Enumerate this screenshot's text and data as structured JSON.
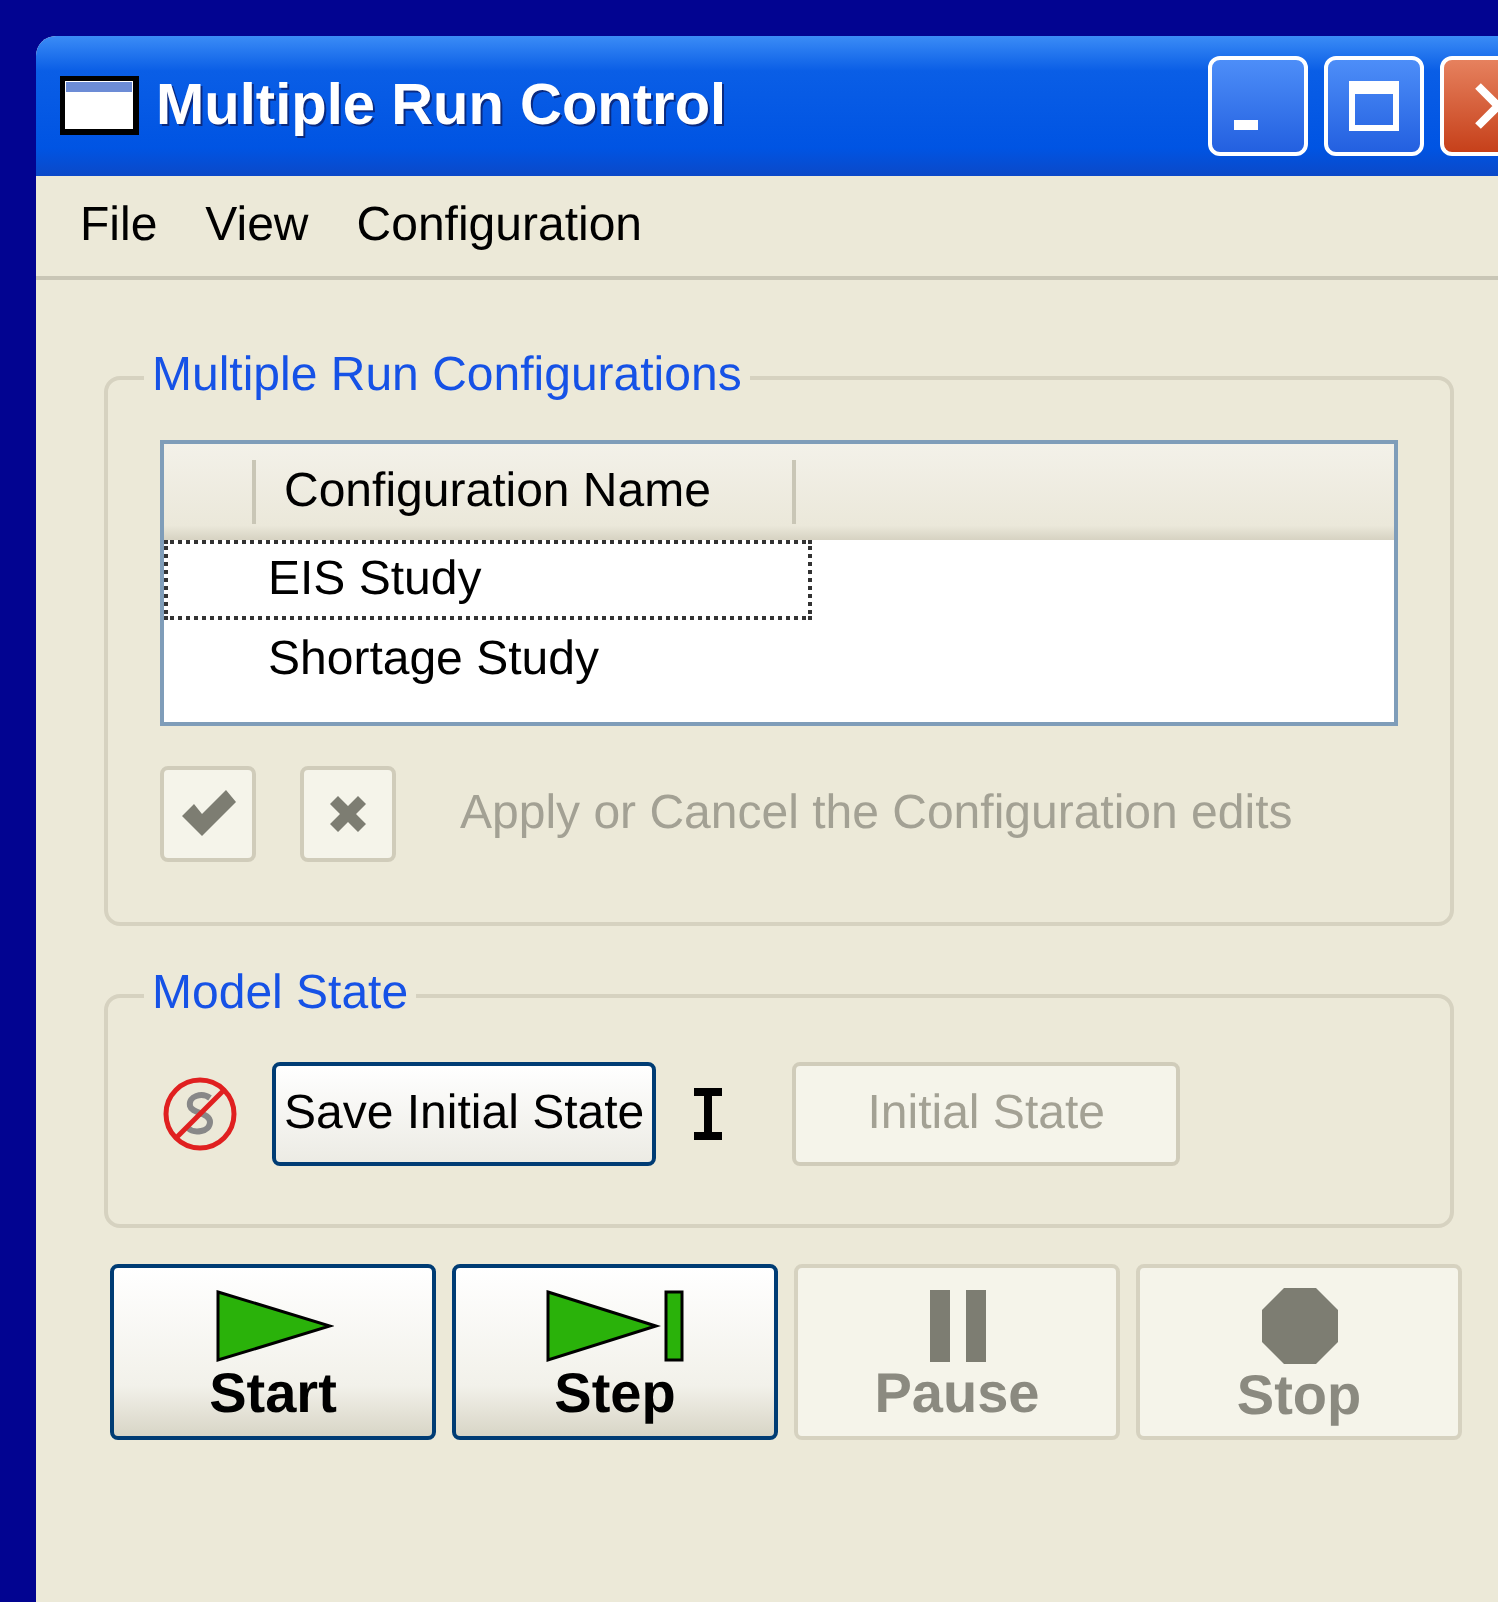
{
  "window": {
    "title": "Multiple Run Control"
  },
  "menu": [
    "File",
    "View",
    "Configuration"
  ],
  "configurations": {
    "legend": "Multiple Run Configurations",
    "columns": [
      "Configuration Name"
    ],
    "rows": [
      {
        "name": "EIS Study",
        "selected": true
      },
      {
        "name": "Shortage Study",
        "selected": false
      }
    ],
    "apply_disabled": true,
    "cancel_disabled": true,
    "hint": "Apply or Cancel the Configuration edits",
    "hint_disabled": true
  },
  "model_state": {
    "legend": "Model State",
    "save_label": "Save Initial State",
    "save_disabled": false,
    "initial_label": "Initial State",
    "initial_disabled": true
  },
  "run_buttons": [
    {
      "kind": "start",
      "label": "Start",
      "disabled": false
    },
    {
      "kind": "step",
      "label": "Step",
      "disabled": false
    },
    {
      "kind": "pause",
      "label": "Pause",
      "disabled": true
    },
    {
      "kind": "stop",
      "label": "Stop",
      "disabled": true
    }
  ]
}
